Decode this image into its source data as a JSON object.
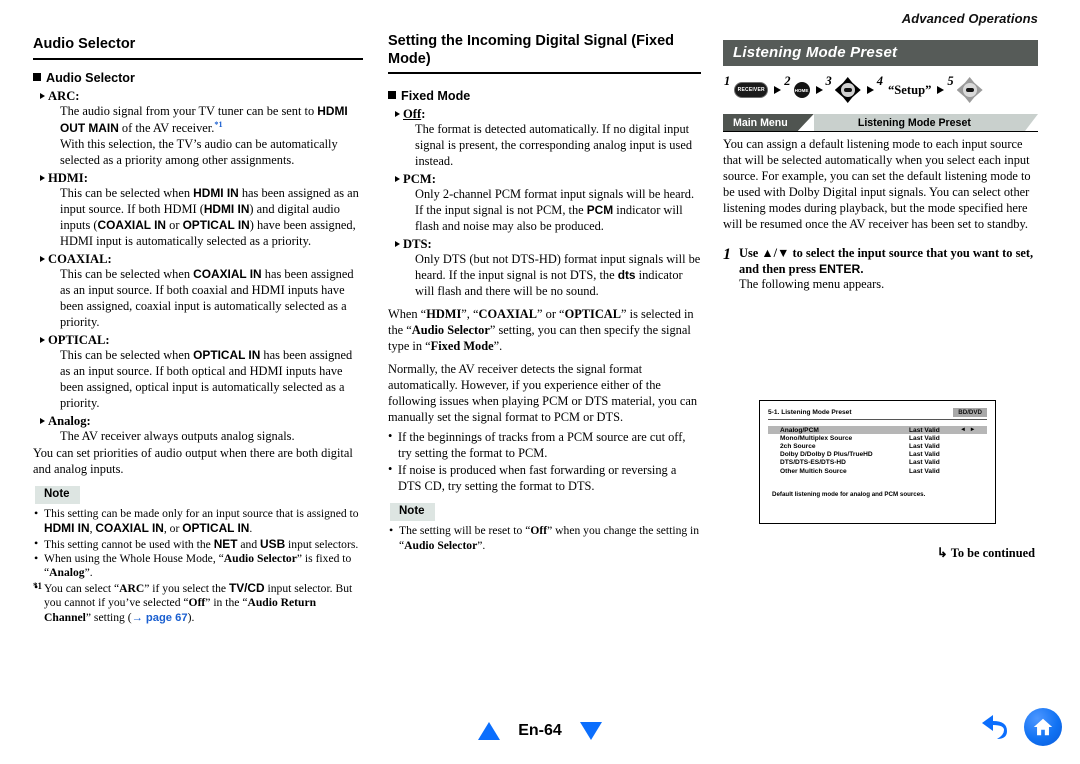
{
  "running_head": "Advanced Operations",
  "left": {
    "section_title": "Audio Selector",
    "sub_title": "Audio Selector",
    "terms": [
      {
        "name": "ARC",
        "body_1": "The audio signal from your TV tuner can be sent to ",
        "bold_1": "HDMI OUT MAIN",
        "body_2": " of the AV receiver.",
        "footnote_mark": "*1",
        "body_3": "With this selection, the TV’s audio can be automatically selected as a priority among other assignments."
      },
      {
        "name": "HDMI",
        "body_1": "This can be selected when ",
        "bold_1": "HDMI IN",
        "body_2": " has been assigned as an input source. If both HDMI (",
        "bold_2": "HDMI IN",
        "body_3": ") and digital audio inputs (",
        "bold_3": "COAXIAL IN",
        "body_4": " or ",
        "bold_4": "OPTICAL IN",
        "body_5": ") have been assigned, HDMI input is automatically selected as a priority."
      },
      {
        "name": "COAXIAL",
        "body_1": "This can be selected when ",
        "bold_1": "COAXIAL IN",
        "body_2": " has been assigned as an input source. If both coaxial and HDMI inputs have been assigned, coaxial input is automatically selected as a priority."
      },
      {
        "name": "OPTICAL",
        "body_1": "This can be selected when ",
        "bold_1": "OPTICAL IN",
        "body_2": " has been assigned as an input source. If both optical and HDMI inputs have been assigned, optical input is automatically selected as a priority."
      },
      {
        "name": "Analog",
        "body_1": "The AV receiver always outputs analog signals."
      }
    ],
    "closing": "You can set priorities of audio output when there are both digital and analog inputs.",
    "note_label": "Note",
    "notes": [
      {
        "p1": "This setting can be made only for an input source that is assigned to ",
        "b1": "HDMI IN",
        "p2": ", ",
        "b2": "COAXIAL IN",
        "p3": ", or ",
        "b3": "OPTICAL IN",
        "p4": "."
      },
      {
        "p1": "This setting cannot be used with the ",
        "b1": "NET",
        "p2": " and ",
        "b2": "USB",
        "p3": " input selectors."
      },
      {
        "p1": "When using the Whole House Mode, “",
        "b1": "Audio Selector",
        "p2": "” is fixed to “",
        "b2": "Analog",
        "p3": "”."
      }
    ],
    "footnote": {
      "mark": "*1",
      "p1": "You can select “",
      "b1": "ARC",
      "p2": "” if you select the ",
      "b2": "TV/CD",
      "p3": " input selector. But you cannot if you’ve selected “",
      "b3": "Off",
      "p4": "” in the “",
      "b4": "Audio Return Channel",
      "p5": "” setting (",
      "link": "→ page 67",
      "p6": ")."
    }
  },
  "mid": {
    "section_title": "Setting the Incoming Digital Signal (Fixed Mode)",
    "sub_title": "Fixed Mode",
    "terms": [
      {
        "name": "Off",
        "underline": true,
        "body_1": "The format is detected automatically. If no digital input signal is present, the corresponding analog input is used instead."
      },
      {
        "name": "PCM",
        "body_1": "Only 2-channel PCM format input signals will be heard. If the input signal is not PCM, the ",
        "bold_1": "PCM",
        "body_2": " indicator will flash and noise may also be produced."
      },
      {
        "name": "DTS",
        "body_1": "Only DTS (but not DTS-HD) format input signals will be heard. If the input signal is not DTS, the ",
        "bold_1": "dts",
        "body_2": " indicator will flash and there will be no sound."
      }
    ],
    "para_1": {
      "p1": "When “",
      "b1": "HDMI",
      "p2": "”, “",
      "b2": "COAXIAL",
      "p3": "” or “",
      "b3": "OPTICAL",
      "p4": "” is selected in the “",
      "b4": "Audio Selector",
      "p5": "” setting, you can then specify the signal type in “",
      "b5": "Fixed Mode",
      "p6": "”."
    },
    "para_2": "Normally, the AV receiver detects the signal format automatically. However, if you experience either of the following issues when playing PCM or DTS material, you can manually set the signal format to PCM or DTS.",
    "bullets": [
      "If the beginnings of tracks from a PCM source are cut off, try setting the format to PCM.",
      "If noise is produced when fast forwarding or reversing a DTS CD, try setting the format to DTS."
    ],
    "note_label": "Note",
    "note": {
      "p1": "The setting will be reset to “",
      "b1": "Off",
      "p2": "” when you change the setting in “",
      "b2": "Audio Selector",
      "p3": "”."
    }
  },
  "right": {
    "title": "Listening Mode Preset",
    "steps": [
      {
        "num": "1",
        "icon": "receiver-button",
        "label": "RECEIVER"
      },
      {
        "num": "2",
        "icon": "home-button",
        "label": "HOME"
      },
      {
        "num": "3",
        "icon": "dpad-black",
        "label": ""
      },
      {
        "num": "4",
        "icon": "text",
        "label": "“Setup”"
      },
      {
        "num": "5",
        "icon": "dpad-gray",
        "label": ""
      }
    ],
    "breadcrumb": {
      "level_1": "Main Menu",
      "level_2": "Listening Mode Preset"
    },
    "intro": "You can assign a default listening mode to each input source that will be selected automatically when you select each input source. For example, you can set the default listening mode to be used with Dolby Digital input signals. You can select other listening modes during playback, but the mode specified here will be resumed once the AV receiver has been set to standby.",
    "step_1": {
      "num": "1",
      "lead_1": "Use ",
      "glyph": "▲/▼",
      "lead_2": " to select the input source that you want to set, and then press ",
      "lead_3": "ENTER",
      "lead_4": ".",
      "follow": "The following menu appears."
    },
    "osd": {
      "title": "5-1. Listening Mode Preset",
      "source_badge": "BD/DVD",
      "rows": [
        {
          "label": "Analog/PCM",
          "value": "Last Valid",
          "selected": true,
          "carets": "◄ ►"
        },
        {
          "label": "Mono/Multiplex Source",
          "value": "Last Valid",
          "selected": false,
          "carets": ""
        },
        {
          "label": "2ch Source",
          "value": "Last Valid",
          "selected": false,
          "carets": ""
        },
        {
          "label": "Dolby D/Dolby D Plus/TrueHD",
          "value": "Last Valid",
          "selected": false,
          "carets": ""
        },
        {
          "label": "DTS/DTS-ES/DTS-HD",
          "value": "Last Valid",
          "selected": false,
          "carets": ""
        },
        {
          "label": "Other Multich Source",
          "value": "Last Valid",
          "selected": false,
          "carets": ""
        }
      ],
      "footer": "Default listening mode for analog and PCM sources."
    },
    "to_be_continued": "To be continued"
  },
  "footer": {
    "page_label": "En-64",
    "prev_icon": "triangle-up-icon",
    "next_icon": "triangle-down-icon",
    "back_icon": "back-arrow-icon",
    "home_icon": "home-icon",
    "accent_color": "#0b6efd"
  }
}
